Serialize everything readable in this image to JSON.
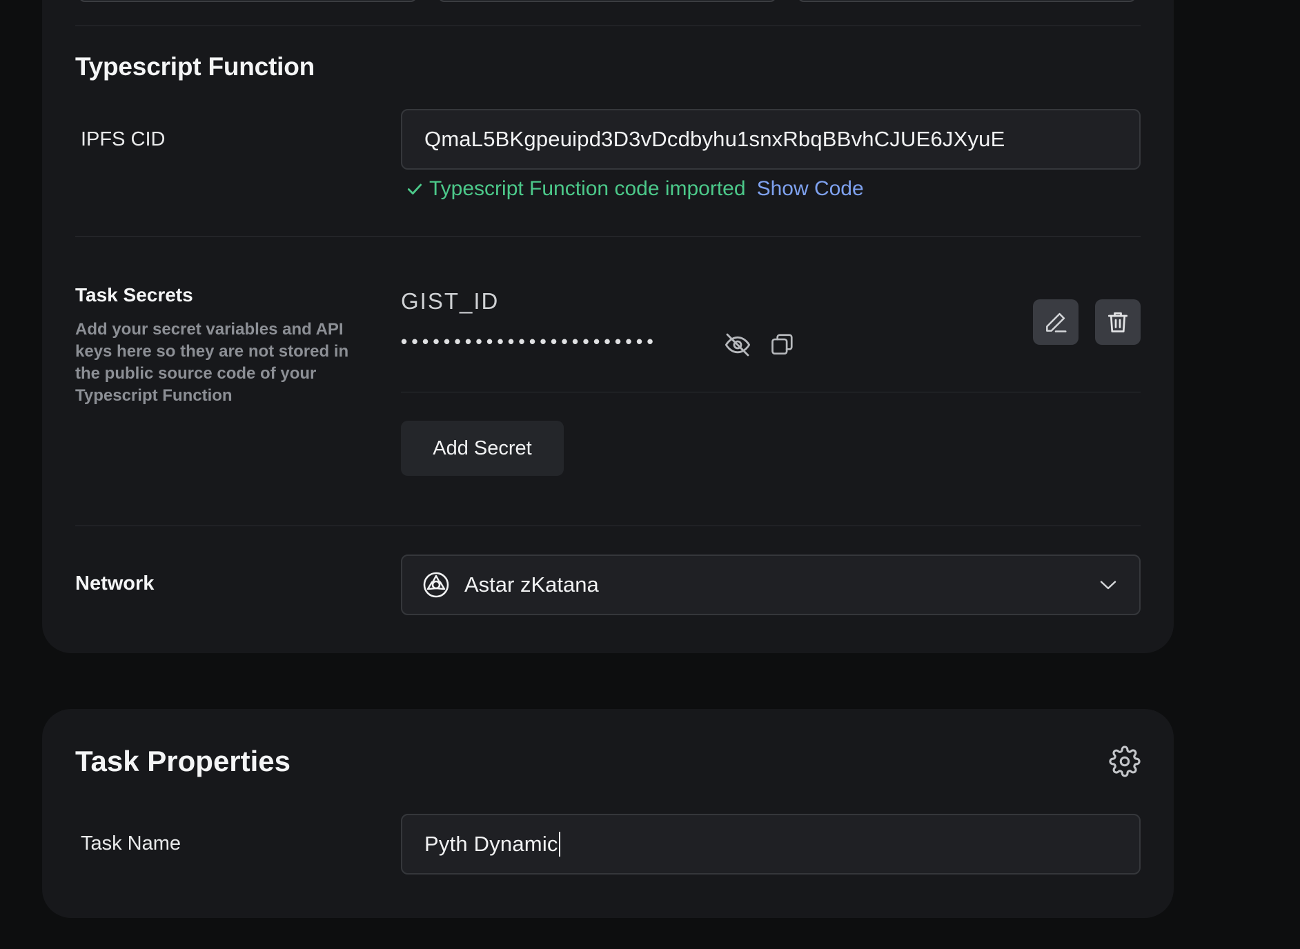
{
  "typescript_function": {
    "title": "Typescript Function",
    "ipfs_label": "IPFS CID",
    "ipfs_value": "QmaL5BKgpeuipd3D3vDcdbyhu1snxRbqBBvhCJUE6JXyuE",
    "status_text": "Typescript Function code imported",
    "show_code_label": "Show Code"
  },
  "task_secrets": {
    "title": "Task Secrets",
    "description": "Add your secret variables and API keys here so they are not stored in the public source code of your Typescript Function",
    "secret_name": "GIST_ID",
    "secret_masked": "••••••••••••••••••••••••",
    "add_secret_label": "Add Secret"
  },
  "network": {
    "label": "Network",
    "selected": "Astar zKatana"
  },
  "task_properties": {
    "title": "Task Properties",
    "task_name_label": "Task Name",
    "task_name_value": "Pyth Dynamic"
  },
  "icons": {
    "status": "check-icon",
    "visibility": "eye-off-icon",
    "copy": "copy-icon",
    "edit": "pencil-icon",
    "delete": "trash-icon",
    "network": "astar-logo-icon",
    "dropdown": "chevron-down-icon",
    "settings": "gear-icon"
  },
  "colors": {
    "success": "#4cc98a",
    "link": "#7ea1ee",
    "card": "#17181b",
    "background": "#0d0e0f"
  }
}
